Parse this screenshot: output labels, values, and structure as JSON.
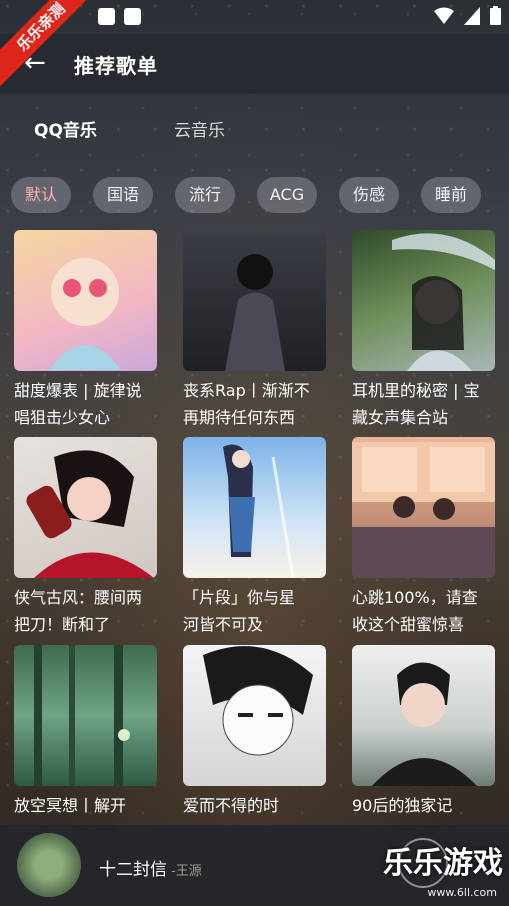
{
  "header": {
    "title": "推荐歌单",
    "badge": "乐乐亲测"
  },
  "tabs": [
    {
      "label": "QQ音乐"
    },
    {
      "label": "云音乐"
    }
  ],
  "chips": [
    "默认",
    "国语",
    "流行",
    "ACG",
    "伤感",
    "睡前"
  ],
  "playlists": [
    {
      "title": "甜度爆表 | 旋律说\n唱狙击少女心",
      "icon": "sailor-moon-cover"
    },
    {
      "title": "丧系Rap丨渐渐不\n再期待任何东西",
      "icon": "hooded-figure-cover"
    },
    {
      "title": "耳机里的秘密 | 宝\n藏女声集合站",
      "icon": "umbrella-girl-cover"
    },
    {
      "title": "侠气古风：腰间两\n把刀！断和了",
      "icon": "red-dress-woman-cover"
    },
    {
      "title": "「片段」你与星\n河皆不可及",
      "icon": "anime-girl-sky-cover"
    },
    {
      "title": "心跳100%，请查\n收这个甜蜜惊喜",
      "icon": "train-couple-cover"
    },
    {
      "title": "放空冥想丨解开\n",
      "icon": "forest-cover"
    },
    {
      "title": "爱而不得的时\n",
      "icon": "manga-boy-cover"
    },
    {
      "title": "90后的独家记\n",
      "icon": "man-glasses-cover"
    }
  ],
  "player": {
    "song": "十二封信",
    "artist": "-王源"
  },
  "watermark": {
    "text": "乐乐游戏",
    "url": "www.6ll.com"
  }
}
